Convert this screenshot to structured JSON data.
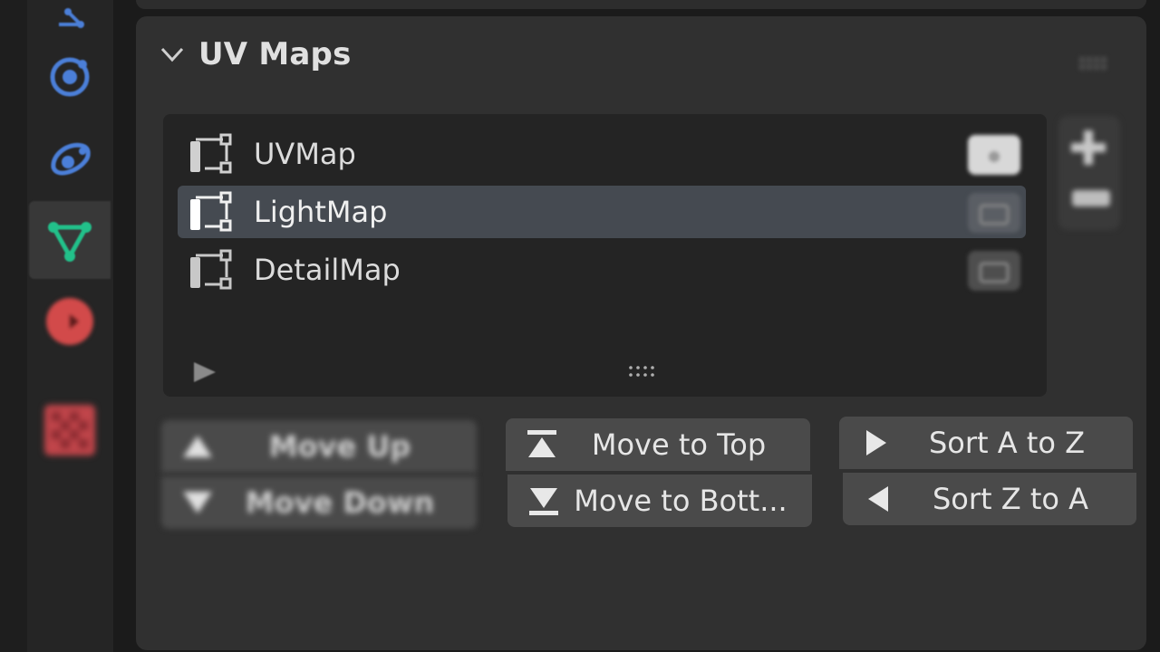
{
  "panel": {
    "title": "UV Maps"
  },
  "uv_list": {
    "items": [
      {
        "name": "UVMap",
        "active_render": true
      },
      {
        "name": "LightMap",
        "active_render": false
      },
      {
        "name": "DetailMap",
        "active_render": false
      }
    ],
    "selected_index": 1
  },
  "buttons": {
    "move_up": "Move Up",
    "move_down": "Move Down",
    "move_to_top": "Move to Top",
    "move_to_bottom": "Move to Bott...",
    "sort_a_z": "Sort A to Z",
    "sort_z_a": "Sort Z to A"
  },
  "tabs": [
    {
      "icon": "constraints-icon",
      "color": "#4b7fd8"
    },
    {
      "icon": "physics-icon",
      "color": "#4b7fd8"
    },
    {
      "icon": "particles-icon",
      "color": "#4b7fd8"
    },
    {
      "icon": "mesh-data-icon",
      "color": "#22c08a",
      "active": true
    },
    {
      "icon": "material-icon",
      "color": "#d24a4a"
    },
    {
      "icon": "texture-icon",
      "color": "#c0454a"
    }
  ],
  "colors": {
    "panel_bg": "#303030",
    "list_bg": "#242424",
    "selected_row": "#454a51",
    "button_bg": "#4a4a4a",
    "accent_mesh": "#22c08a"
  }
}
